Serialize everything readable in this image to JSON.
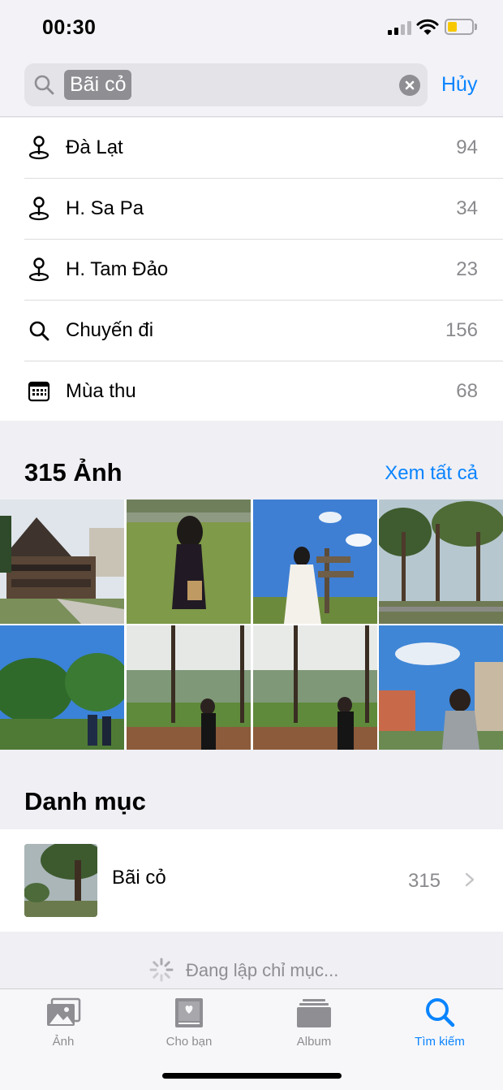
{
  "status_bar": {
    "time": "00:30"
  },
  "search": {
    "query": "Bãi cỏ",
    "cancel_label": "Hủy"
  },
  "suggestions": [
    {
      "icon": "map-pin-icon",
      "label": "Đà Lạt",
      "count": "94"
    },
    {
      "icon": "map-pin-icon",
      "label": "H. Sa Pa",
      "count": "34"
    },
    {
      "icon": "map-pin-icon",
      "label": "H. Tam Đảo",
      "count": "23"
    },
    {
      "icon": "search-icon",
      "label": "Chuyến đi",
      "count": "156"
    },
    {
      "icon": "calendar-icon",
      "label": "Mùa thu",
      "count": "68"
    }
  ],
  "photos_section": {
    "title": "315 Ảnh",
    "see_all_label": "Xem tất cả"
  },
  "categories_section": {
    "title": "Danh mục",
    "item": {
      "label": "Bãi cỏ",
      "count": "315"
    }
  },
  "indexing": {
    "text": "Đang lập chỉ mục..."
  },
  "tab_bar": {
    "tabs": [
      {
        "label": "Ảnh",
        "icon": "photos-icon",
        "active": false
      },
      {
        "label": "Cho bạn",
        "icon": "for-you-icon",
        "active": false
      },
      {
        "label": "Album",
        "icon": "album-icon",
        "active": false
      },
      {
        "label": "Tìm kiếm",
        "icon": "search-icon",
        "active": true
      }
    ]
  },
  "colors": {
    "accent": "#0a84ff",
    "secondary_text": "#8a8a8e",
    "battery": "#f7c800"
  }
}
